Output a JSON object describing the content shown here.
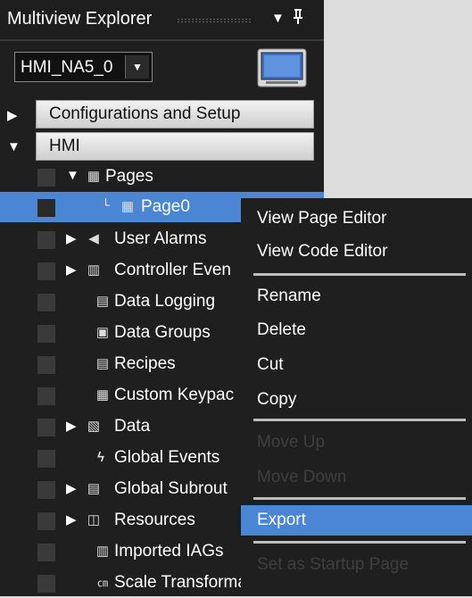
{
  "panel": {
    "title": "Multiview Explorer",
    "dropdown_icon": "dropdown-arrow-icon",
    "pin_icon": "pin-icon"
  },
  "device": {
    "selected": "HMI_NA5_0",
    "arrow_icon": "chevron-down-icon",
    "monitor_icon": "monitor-icon"
  },
  "sections": {
    "configurations": "Configurations and Setup",
    "hmi": "HMI"
  },
  "tree": [
    {
      "label": "Pages",
      "icon": "pages-icon",
      "expanded": true
    },
    {
      "label": "Page0",
      "icon": "page-icon",
      "selected": true
    },
    {
      "label": "User Alarms",
      "icon": "speaker-icon"
    },
    {
      "label": "Controller Even",
      "icon": "calendar-icon"
    },
    {
      "label": "Data Logging",
      "icon": "data-logging-icon"
    },
    {
      "label": "Data Groups",
      "icon": "data-groups-icon"
    },
    {
      "label": "Recipes",
      "icon": "recipes-icon"
    },
    {
      "label": "Custom Keypac",
      "icon": "keypad-icon"
    },
    {
      "label": "Data",
      "icon": "data-icon"
    },
    {
      "label": "Global Events",
      "icon": "lightning-icon"
    },
    {
      "label": "Global Subrout",
      "icon": "subroutine-icon"
    },
    {
      "label": "Resources",
      "icon": "resources-icon"
    },
    {
      "label": "Imported IAGs",
      "icon": "iag-icon"
    },
    {
      "label": "Scale Transformations",
      "icon": "scale-icon"
    }
  ],
  "context_menu": {
    "view_page_editor": "View Page Editor",
    "view_code_editor": "View Code Editor",
    "rename": "Rename",
    "delete": "Delete",
    "cut": "Cut",
    "copy": "Copy",
    "move_up": "Move Up",
    "move_down": "Move Down",
    "export": "Export",
    "set_as_startup": "Set as Startup Page"
  },
  "colors": {
    "panel_bg": "#1f1f1f",
    "selection": "#4a86d4",
    "disabled_text": "#3f3f3f"
  }
}
